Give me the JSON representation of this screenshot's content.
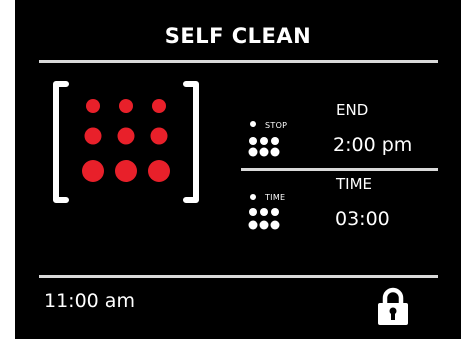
{
  "screen": {
    "title": "SELF CLEAN"
  },
  "stop_section": {
    "icon_caption": "STOP",
    "label": "END",
    "value": "2:00 pm"
  },
  "time_section": {
    "icon_caption": "TIME",
    "label": "TIME",
    "value": "03:00"
  },
  "status_bar": {
    "clock": "11:00 am",
    "lock_icon": "lock-icon"
  },
  "colors": {
    "background": "#000000",
    "text": "#ffffff",
    "divider": "#d9d9d9",
    "heat_indicator": "#e8202a"
  },
  "icons": {
    "oven_heat_grid": "oven-heat-grid-icon",
    "stop_dots": "stop-dots-icon",
    "time_dots": "time-dots-icon"
  }
}
